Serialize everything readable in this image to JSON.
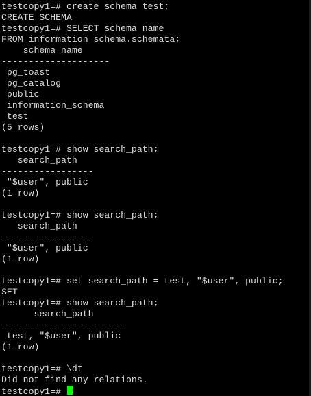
{
  "terminal": {
    "lines": [
      "testcopy1=# create schema test;",
      "CREATE SCHEMA",
      "testcopy1=# SELECT schema_name",
      "FROM information_schema.schemata;",
      "    schema_name",
      "--------------------",
      " pg_toast",
      " pg_catalog",
      " public",
      " information_schema",
      " test",
      "(5 rows)",
      "",
      "testcopy1=# show search_path;",
      "   search_path",
      "-----------------",
      " \"$user\", public",
      "(1 row)",
      "",
      "testcopy1=# show search_path;",
      "   search_path",
      "-----------------",
      " \"$user\", public",
      "(1 row)",
      "",
      "testcopy1=# set search_path = test, \"$user\", public;",
      "SET",
      "testcopy1=# show search_path;",
      "      search_path",
      "-----------------------",
      " test, \"$user\", public",
      "(1 row)",
      "",
      "testcopy1=# \\dt",
      "Did not find any relations."
    ],
    "current_prompt": "testcopy1=# ",
    "text_color": "#d9d9d9",
    "background_color": "#000000",
    "cursor_color": "#00ff00"
  }
}
